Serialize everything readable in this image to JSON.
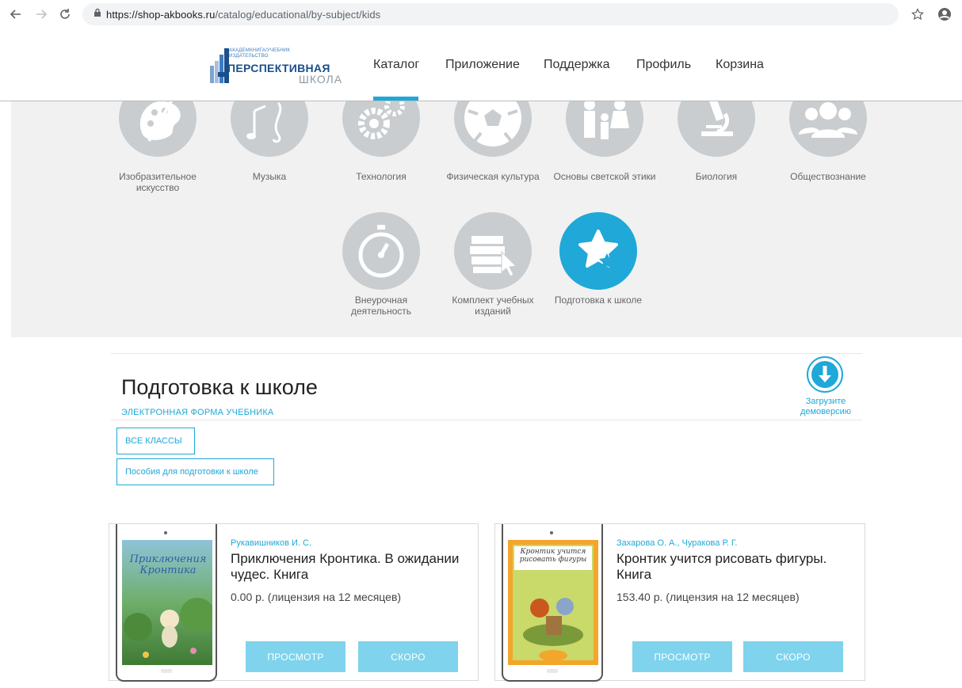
{
  "browser": {
    "url_host": "https://shop-akbooks.ru",
    "url_path": "/catalog/educational/by-subject/kids"
  },
  "header": {
    "logo_small_line1": "АКАДЕМКНИГА/УЧЕБНИК",
    "logo_small_line2": "ИЗДАТЕЛЬСТВО",
    "logo_big_line1": "ПЕРСПЕКТИВНАЯ",
    "logo_big_line2": "ШКОЛА",
    "nav": [
      "Каталог",
      "Приложение",
      "Поддержка",
      "Профиль",
      "Корзина"
    ],
    "active_nav": "Каталог"
  },
  "subjects": [
    {
      "label": "Изобразительное искусство",
      "icon": "palette-icon"
    },
    {
      "label": "Музыка",
      "icon": "music-note-icon"
    },
    {
      "label": "Технология",
      "icon": "gears-icon"
    },
    {
      "label": "Физическая культура",
      "icon": "soccer-ball-icon"
    },
    {
      "label": "Основы светской этики",
      "icon": "family-icon"
    },
    {
      "label": "Биология",
      "icon": "microscope-icon"
    },
    {
      "label": "Обществознание",
      "icon": "people-icon"
    },
    {
      "label": "Внеурочная деятельность",
      "icon": "stopwatch-icon"
    },
    {
      "label": "Комплект учебных изданий",
      "icon": "books-cursor-icon"
    },
    {
      "label": "Подготовка к школе",
      "icon": "star-icon",
      "active": true
    }
  ],
  "section": {
    "title": "Подготовка к школе",
    "subtitle": "ЭЛЕКТРОННАЯ ФОРМА УЧЕБНИКА",
    "download_label": "Загрузите демоверсию",
    "filters": [
      "ВСЕ КЛАССЫ",
      "Пособия для подготовки к школе"
    ]
  },
  "products": [
    {
      "author": "Рукавишников И. С.",
      "title": "Приключения Кронтика. В ожидании чудес. Книга",
      "price": "0.00 р. (лицензия на 12 месяцев)",
      "view_label": "ПРОСМОТР",
      "soon_label": "СКОРО",
      "cover_text": "Приключения Кронтика"
    },
    {
      "author": "Захарова О. А., Чуракова Р. Г.",
      "title": "Кронтик учится рисовать фигуры. Книга",
      "price": "153.40 р. (лицензия на 12 месяцев)",
      "view_label": "ПРОСМОТР",
      "soon_label": "СКОРО",
      "cover_text": "Кронтик учится рисовать фигуры"
    }
  ],
  "colors": {
    "accent": "#1fa8d8",
    "button": "#7fd3ec",
    "circle": "#c9cdd0",
    "panel": "#f1f1f1"
  }
}
